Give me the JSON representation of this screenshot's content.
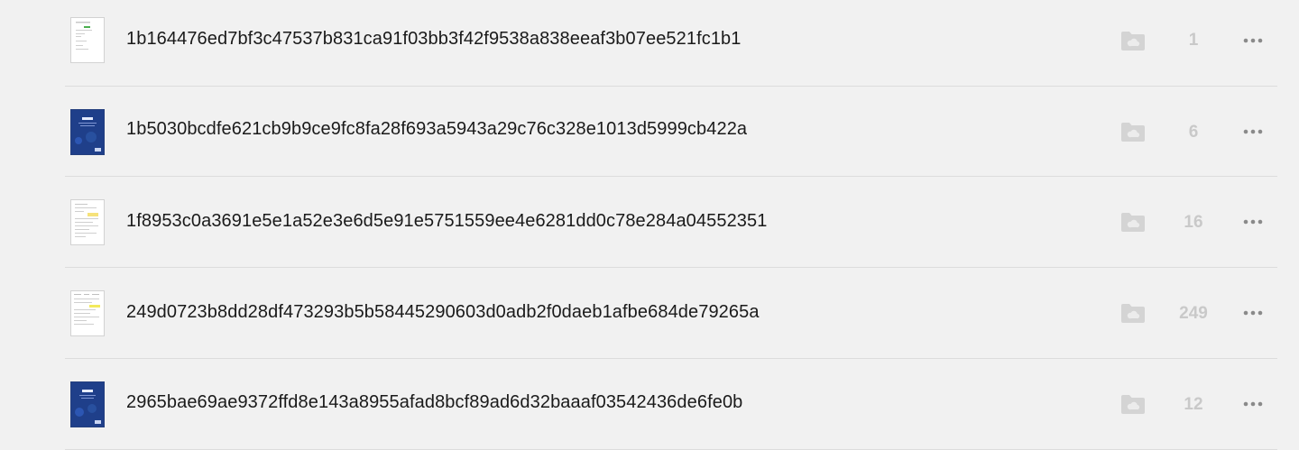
{
  "files": [
    {
      "name": "1b164476ed7bf3c47537b831ca91f03bb3f42f9538a838eeaf3b07ee521fc1b1",
      "count": "1",
      "thumbnail": "light",
      "folder_icon": "folder-icon",
      "menu_icon": "more-horizontal-icon"
    },
    {
      "name": "1b5030bcdfe621cb9b9ce9fc8fa28f693a5943a29c76c328e1013d5999cb422a",
      "count": "6",
      "thumbnail": "dark",
      "folder_icon": "folder-icon",
      "menu_icon": "more-horizontal-icon"
    },
    {
      "name": "1f8953c0a3691e5e1a52e3e6d5e91e5751559ee4e6281dd0c78e284a04552351",
      "count": "16",
      "thumbnail": "light",
      "folder_icon": "folder-icon",
      "menu_icon": "more-horizontal-icon"
    },
    {
      "name": "249d0723b8dd28df473293b5b58445290603d0adb2f0daeb1afbe684de79265a",
      "count": "249",
      "thumbnail": "light",
      "folder_icon": "folder-icon",
      "menu_icon": "more-horizontal-icon"
    },
    {
      "name": "2965bae69ae9372ffd8e143a8955afad8bcf89ad6d32baaaf03542436de6fe0b",
      "count": "12",
      "thumbnail": "dark",
      "folder_icon": "folder-icon",
      "menu_icon": "more-horizontal-icon"
    }
  ],
  "colors": {
    "background": "#f1f1f1",
    "text": "#1a1a1a",
    "muted_count": "#c9c9c9",
    "folder_icon": "#d4d4d4",
    "menu_dots": "#8a8a8a",
    "dark_thumbnail": "#1f3f8a"
  }
}
